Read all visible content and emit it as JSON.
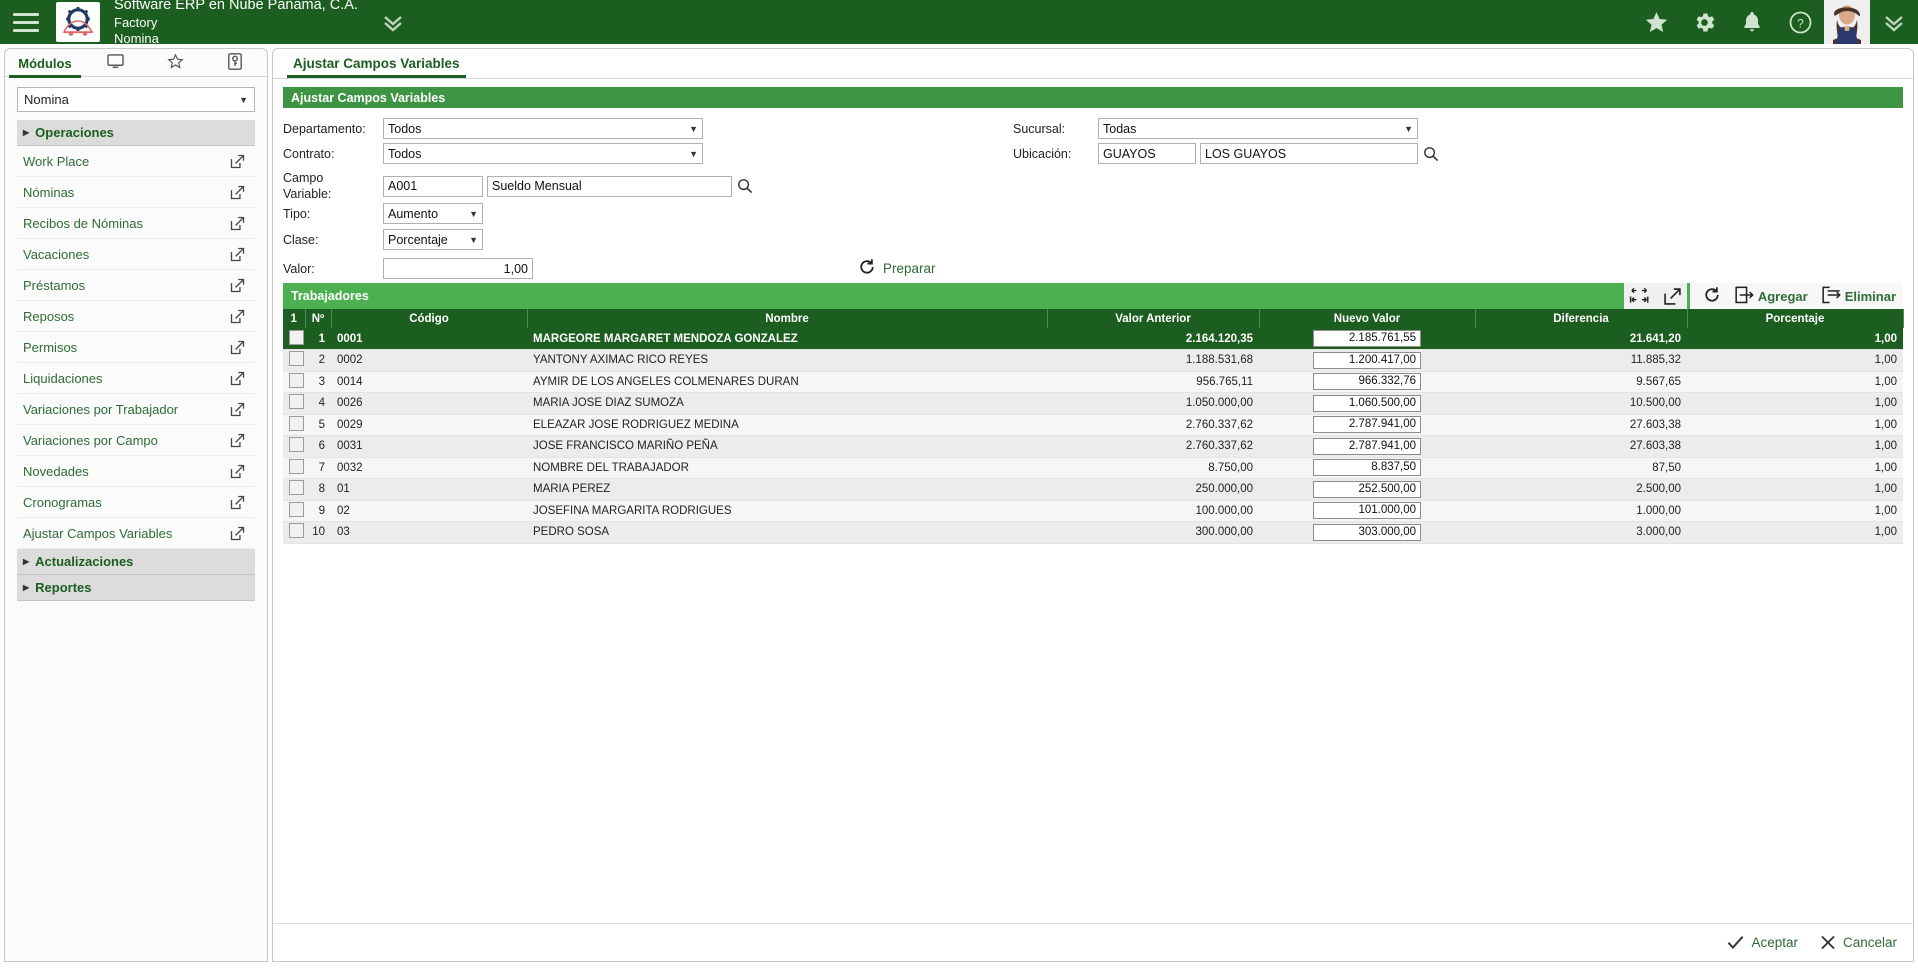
{
  "topbar": {
    "company": "Software ERP en Nube Panama, C.A.",
    "branch": "Factory",
    "module": "Nomina",
    "icons": [
      "star-icon",
      "gear-icon",
      "bell-icon",
      "help-icon"
    ]
  },
  "sidebar": {
    "tabs": [
      {
        "label": "Módulos",
        "name": "tab-modulos"
      },
      {
        "label": "",
        "name": "tab-monitor"
      },
      {
        "label": "",
        "name": "tab-favoritos"
      },
      {
        "label": "",
        "name": "tab-accesos"
      }
    ],
    "module_select": {
      "value": "Nomina"
    },
    "groups": [
      {
        "label": "Operaciones",
        "expanded": true
      },
      {
        "label": "Actualizaciones",
        "expanded": false
      },
      {
        "label": "Reportes",
        "expanded": false
      }
    ],
    "items": [
      {
        "label": "Work Place"
      },
      {
        "label": "Nóminas"
      },
      {
        "label": "Recibos de Nóminas"
      },
      {
        "label": "Vacaciones"
      },
      {
        "label": "Préstamos"
      },
      {
        "label": "Reposos"
      },
      {
        "label": "Permisos"
      },
      {
        "label": "Liquidaciones"
      },
      {
        "label": "Variaciones por Trabajador"
      },
      {
        "label": "Variaciones por Campo"
      },
      {
        "label": "Novedades"
      },
      {
        "label": "Cronogramas"
      },
      {
        "label": "Ajustar Campos Variables"
      }
    ]
  },
  "content": {
    "tab_label": "Ajustar Campos Variables",
    "section_title": "Ajustar Campos Variables",
    "form": {
      "departamento_label": "Departamento:",
      "departamento_value": "Todos",
      "contrato_label": "Contrato:",
      "contrato_value": "Todos",
      "campo_variable_label_l1": "Campo",
      "campo_variable_label_l2": "Variable:",
      "campo_variable_code": "A001",
      "campo_variable_name": "Sueldo Mensual",
      "tipo_label": "Tipo:",
      "tipo_value": "Aumento",
      "clase_label": "Clase:",
      "clase_value": "Porcentaje",
      "valor_label": "Valor:",
      "valor_value": "1,00",
      "preparar_label": "Preparar",
      "sucursal_label": "Sucursal:",
      "sucursal_value": "Todas",
      "ubicacion_label": "Ubicación:",
      "ubicacion_code": "GUAYOS",
      "ubicacion_name": "LOS GUAYOS"
    },
    "grid": {
      "title": "Trabajadores",
      "toolbar": {
        "agregar_label": "Agregar",
        "eliminar_label": "Eliminar"
      },
      "columns": [
        {
          "label": "1",
          "name": "select-all"
        },
        {
          "label": "Nº",
          "name": "col-numero"
        },
        {
          "label": "Código",
          "name": "col-codigo"
        },
        {
          "label": "Nombre",
          "name": "col-nombre"
        },
        {
          "label": "Valor Anterior",
          "name": "col-valor-anterior"
        },
        {
          "label": "Nuevo Valor",
          "name": "col-nuevo-valor"
        },
        {
          "label": "Diferencia",
          "name": "col-diferencia"
        },
        {
          "label": "Porcentaje",
          "name": "col-porcentaje"
        }
      ],
      "rows": [
        {
          "n": "1",
          "codigo": "0001",
          "nombre": "MARGEORE MARGARET MENDOZA GONZALEZ",
          "valor_anterior": "2.164.120,35",
          "nuevo_valor": "2.185.761,55",
          "diferencia": "21.641,20",
          "porcentaje": "1,00",
          "selected": true
        },
        {
          "n": "2",
          "codigo": "0002",
          "nombre": "YANTONY AXIMAC RICO REYES",
          "valor_anterior": "1.188.531,68",
          "nuevo_valor": "1.200.417,00",
          "diferencia": "11.885,32",
          "porcentaje": "1,00",
          "selected": false
        },
        {
          "n": "3",
          "codigo": "0014",
          "nombre": "AYMIR DE LOS ANGELES COLMENARES DURAN",
          "valor_anterior": "956.765,11",
          "nuevo_valor": "966.332,76",
          "diferencia": "9.567,65",
          "porcentaje": "1,00",
          "selected": false
        },
        {
          "n": "4",
          "codigo": "0026",
          "nombre": "MARIA JOSE DIAZ SUMOZA",
          "valor_anterior": "1.050.000,00",
          "nuevo_valor": "1.060.500,00",
          "diferencia": "10.500,00",
          "porcentaje": "1,00",
          "selected": false
        },
        {
          "n": "5",
          "codigo": "0029",
          "nombre": "ELEAZAR JOSE RODRIGUEZ MEDINA",
          "valor_anterior": "2.760.337,62",
          "nuevo_valor": "2.787.941,00",
          "diferencia": "27.603,38",
          "porcentaje": "1,00",
          "selected": false
        },
        {
          "n": "6",
          "codigo": "0031",
          "nombre": "JOSE FRANCISCO MARIÑO PEÑA",
          "valor_anterior": "2.760.337,62",
          "nuevo_valor": "2.787.941,00",
          "diferencia": "27.603,38",
          "porcentaje": "1,00",
          "selected": false
        },
        {
          "n": "7",
          "codigo": "0032",
          "nombre": "NOMBRE DEL TRABAJADOR",
          "valor_anterior": "8.750,00",
          "nuevo_valor": "8.837,50",
          "diferencia": "87,50",
          "porcentaje": "1,00",
          "selected": false
        },
        {
          "n": "8",
          "codigo": "01",
          "nombre": "MARIA PEREZ",
          "valor_anterior": "250.000,00",
          "nuevo_valor": "252.500,00",
          "diferencia": "2.500,00",
          "porcentaje": "1,00",
          "selected": false
        },
        {
          "n": "9",
          "codigo": "02",
          "nombre": "JOSEFINA MARGARITA RODRIGUES",
          "valor_anterior": "100.000,00",
          "nuevo_valor": "101.000,00",
          "diferencia": "1.000,00",
          "porcentaje": "1,00",
          "selected": false
        },
        {
          "n": "10",
          "codigo": "03",
          "nombre": "PEDRO SOSA",
          "valor_anterior": "300.000,00",
          "nuevo_valor": "303.000,00",
          "diferencia": "3.000,00",
          "porcentaje": "1,00",
          "selected": false
        }
      ]
    },
    "footer": {
      "aceptar_label": "Aceptar",
      "cancelar_label": "Cancelar"
    }
  },
  "colors": {
    "brand_dark_green": "#1b5e20",
    "brand_green": "#4caf50",
    "section_green": "#3d9443",
    "link_green": "#2f6b37",
    "row_even": "#f6f6f6",
    "row_odd": "#ececec"
  }
}
